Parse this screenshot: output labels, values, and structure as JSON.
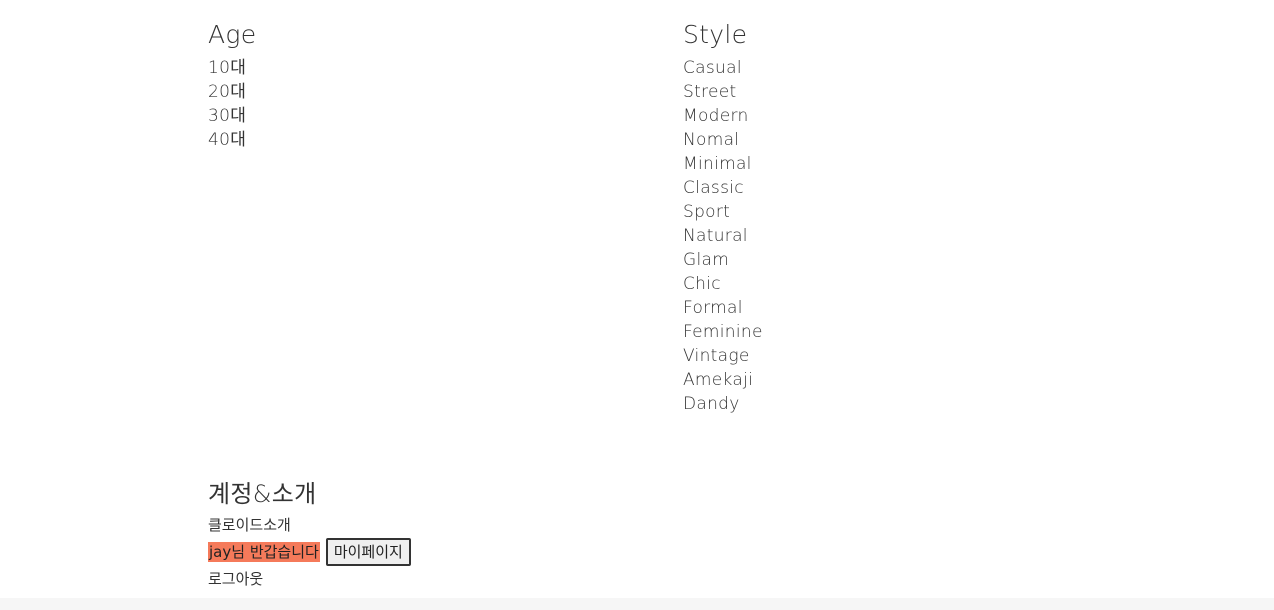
{
  "age": {
    "title": "Age",
    "items": [
      "10대",
      "20대",
      "30대",
      "40대"
    ]
  },
  "style": {
    "title": "Style",
    "items": [
      "Casual",
      "Street",
      "Modern",
      "Nomal",
      "Minimal",
      "Classic",
      "Sport",
      "Natural",
      "Glam",
      "Chic",
      "Formal",
      "Feminine",
      "Vintage",
      "Amekaji",
      "Dandy"
    ]
  },
  "account": {
    "title": "계정&소개",
    "intro_link": "클로이드소개",
    "username": "jay",
    "greeting_suffix": "님 반갑습니다",
    "mypage_button": "마이페이지",
    "logout_link": "로그아웃"
  },
  "colors": {
    "greeting_highlight": "#f57a5a",
    "text": "#333333"
  }
}
